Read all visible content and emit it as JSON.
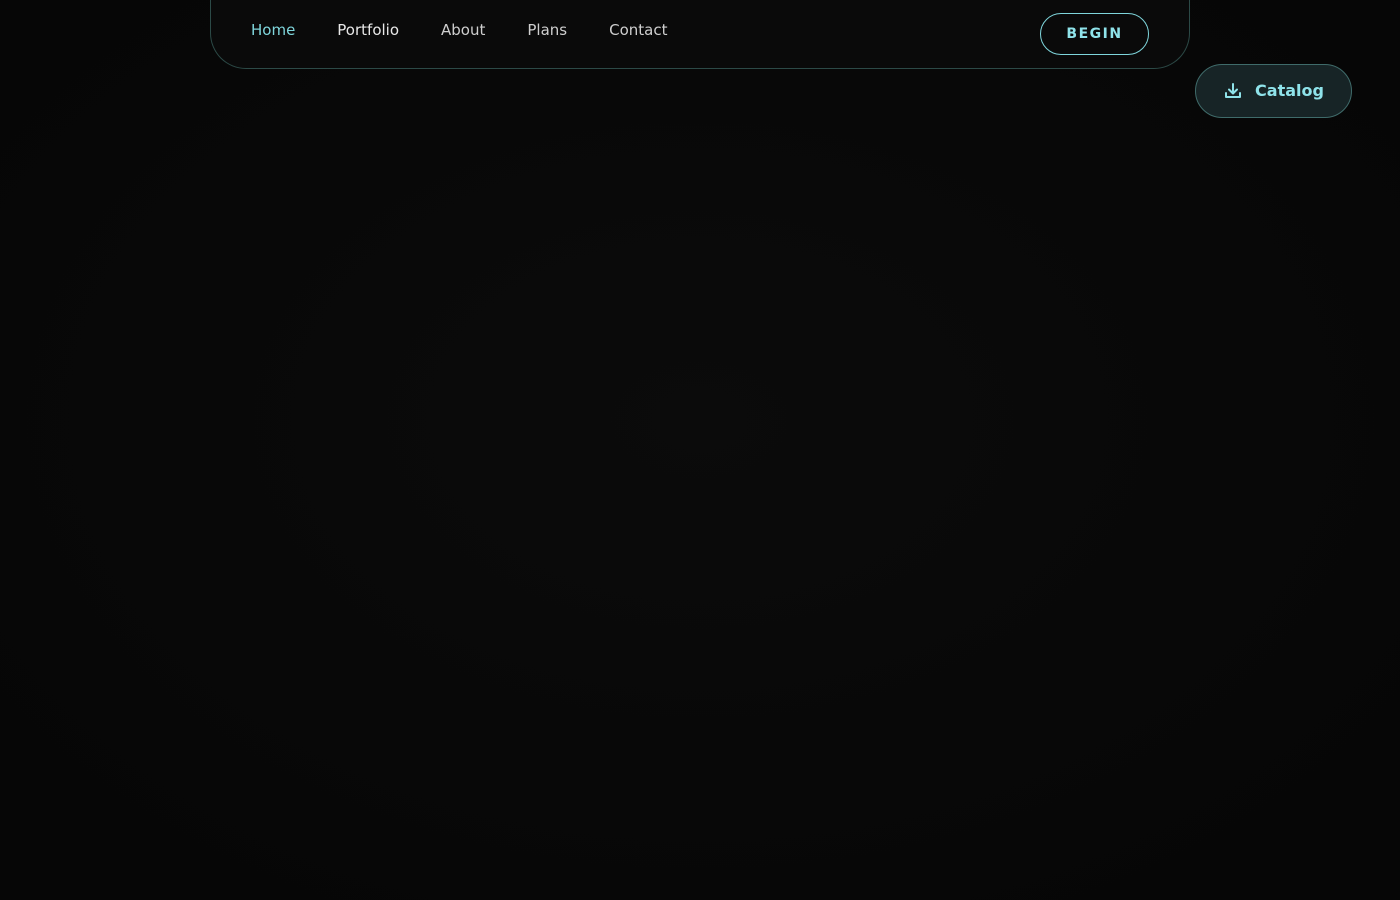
{
  "nav": {
    "links": [
      {
        "label": "Home",
        "state": "active"
      },
      {
        "label": "Portfolio",
        "state": "hover"
      },
      {
        "label": "About",
        "state": "default"
      },
      {
        "label": "Plans",
        "state": "default"
      },
      {
        "label": "Contact",
        "state": "default"
      }
    ],
    "cta_label": "BEGIN"
  },
  "catalog_button": {
    "label": "Catalog",
    "icon": "download-icon"
  },
  "colors": {
    "background": "#080808",
    "accent": "#8fe3ea",
    "nav_border": "#2c4a47",
    "catalog_bg": "#172426"
  }
}
